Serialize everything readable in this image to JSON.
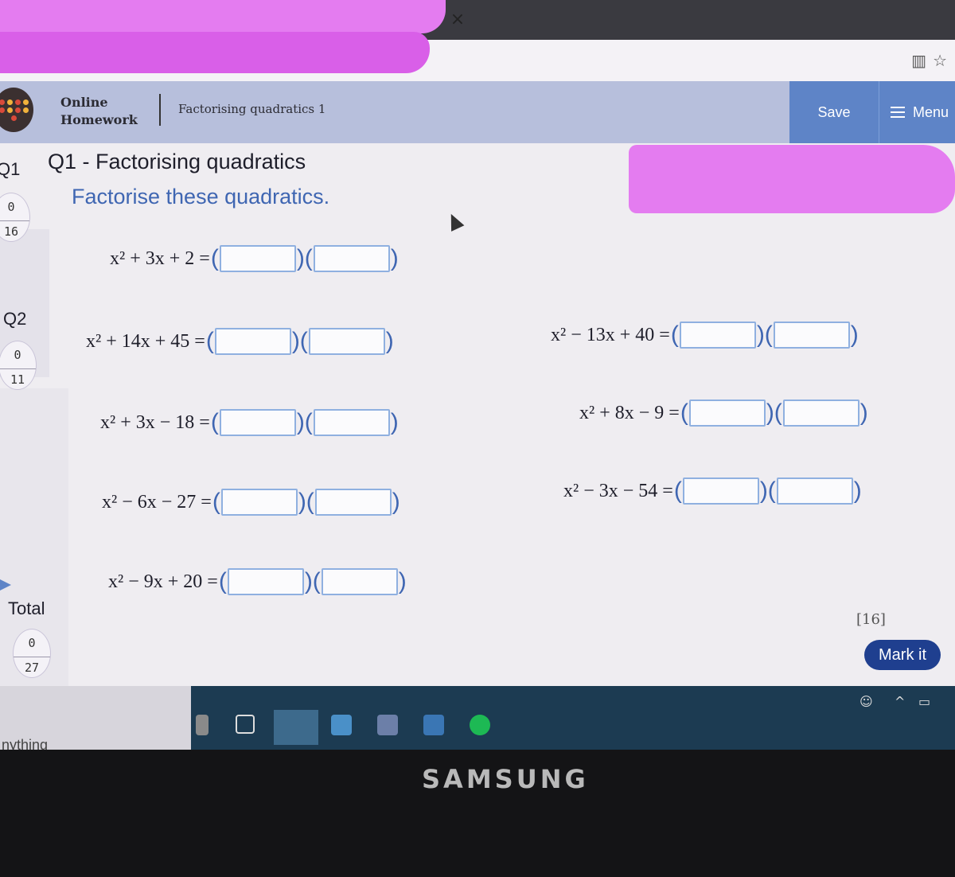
{
  "browser": {
    "tab_close": "×",
    "icons": [
      "reading-view-icon",
      "favorite-star-icon"
    ]
  },
  "header": {
    "brand_line1": "Online",
    "brand_line2": "Homework",
    "assignment_title": "Factorising quadratics 1",
    "save_label": "Save",
    "menu_label": "Menu"
  },
  "sidebar": {
    "questions": [
      {
        "label": "Q1",
        "score": "0",
        "max": "16"
      },
      {
        "label": "Q2",
        "score": "0",
        "max": "11"
      }
    ],
    "total": {
      "label": "Total",
      "score": "0",
      "max": "27"
    }
  },
  "main": {
    "heading": "Q1 - Factorising quadratics",
    "instruction": "Factorise these quadratics.",
    "equations": [
      {
        "lhs": "x² + 3x + 2 ="
      },
      {
        "lhs": "x² + 14x + 45 ="
      },
      {
        "lhs": "x² − 13x + 40 ="
      },
      {
        "lhs": "x² + 3x − 18 ="
      },
      {
        "lhs": "x² + 8x − 9 ="
      },
      {
        "lhs": "x² − 6x − 27 ="
      },
      {
        "lhs": "x² − 3x − 54 ="
      },
      {
        "lhs": "x² − 9x + 20 ="
      }
    ],
    "paren_open": "(",
    "paren_mid": ")(",
    "paren_close": ")",
    "marks": "[16]",
    "mark_button": "Mark it"
  },
  "taskbar": {
    "search_text": "nything",
    "sys_tray": [
      "^"
    ]
  },
  "bezel": {
    "brand": "SAMSUNG"
  },
  "colors": {
    "header_bg": "#b7bfdc",
    "button_blue": "#5e84c7",
    "mark_button": "#1f3f8f",
    "instruction_blue": "#3f66b2",
    "input_border": "#8fb0e0"
  }
}
